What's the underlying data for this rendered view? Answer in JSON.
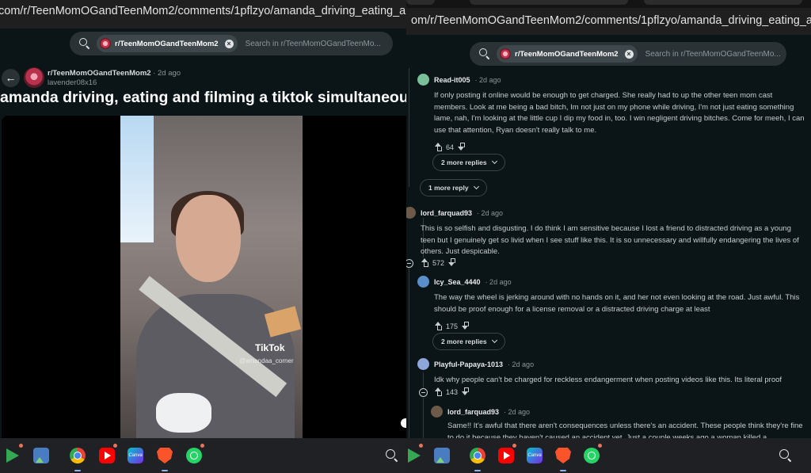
{
  "left": {
    "url": "com/r/TeenMomOGandTeenMom2/comments/1pflzyo/amanda_driving_eating_and_filming_a_tiktok",
    "search": {
      "community": "r/TeenMomOGandTeenMom2",
      "placeholder": "Search in r/TeenMomOGandTeenMo..."
    },
    "post": {
      "subreddit": "r/TeenMomOGandTeenMom2",
      "age": "· 2d ago",
      "author": "lavender08x16",
      "title": "amanda driving, eating and filming a tiktok simultaneously",
      "video_watermark": "TikTok",
      "video_handle": "@amandaa_corner"
    }
  },
  "right": {
    "url": "om/r/TeenMomOGandTeenMom2/comments/1pflzyo/amanda_driving_eating_and_filming_a_tiktok/",
    "search": {
      "community": "r/TeenMomOGandTeenMom2",
      "placeholder": "Search in r/TeenMomOGandTeenMo..."
    },
    "comments": [
      {
        "user": "Read-it005",
        "age": "· 2d ago",
        "body": "If only posting it online would be enough to get charged. She really had to up the other teen mom cast members. Look at me being a bad bitch, Im not just on my phone while driving, I'm not just eating something lame, nah, I'm looking at the little cup I dip my food in, too. I win negligent driving bitches. Come for meeh, I can use that attention, Ryan doesn't really talk to me.",
        "votes": "64",
        "more": "2 more replies"
      },
      {
        "more": "1 more reply"
      },
      {
        "user": "lord_farquad93",
        "age": "· 2d ago",
        "body": "This is so selfish and disgusting. I do think I am sensitive because I lost a friend to distracted driving as a young teen but I genuinely get so livid when I see stuff like this. It is so unnecessary and willfully endangering the lives of others. Just despicable.",
        "votes": "572"
      },
      {
        "user": "Icy_Sea_4440",
        "age": "· 2d ago",
        "body": "The way the wheel is jerking around with no hands on it, and her not even looking at the road. Just awful. This should be proof enough for a license removal or a distracted driving charge at least",
        "votes": "175",
        "more": "2 more replies"
      },
      {
        "user": "Playful-Papaya-1013",
        "age": "· 2d ago",
        "body": "Idk why people can't be charged for reckless endangerment when posting videos like this. Its literal proof",
        "votes": "143"
      },
      {
        "user": "lord_farquad93",
        "age": "· 2d ago",
        "body": "Same!! It's awful that there aren't consequences unless there's an accident. These people think they're fine to do it because they haven't caused an accident yet. Just a couple weeks ago a woman killed a"
      }
    ]
  },
  "taskbar": {
    "apps": [
      "play-store",
      "photos",
      "chrome",
      "youtube",
      "canva",
      "brave",
      "whatsapp"
    ],
    "canva_label": "Canva"
  }
}
